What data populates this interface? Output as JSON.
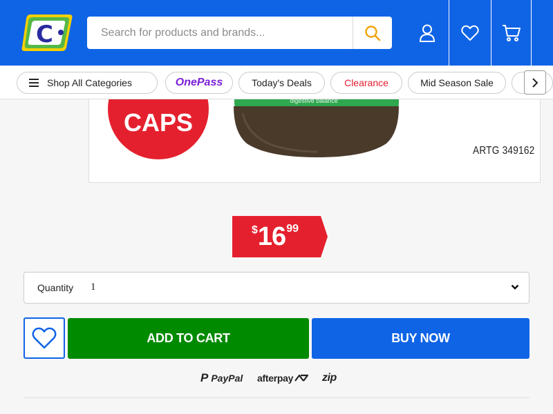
{
  "header": {
    "search_placeholder": "Search for products and brands...",
    "brand_color": "#0f64e6"
  },
  "nav": {
    "all_categories": "Shop All Categories",
    "onepass": "OnePass",
    "deals": "Today's Deals",
    "clearance": "Clearance",
    "mid_season": "Mid Season Sale",
    "next_arrow": "›"
  },
  "product_image": {
    "badge_text": "CAPS",
    "label_text": "digestive balance",
    "artg": "ARTG 349162"
  },
  "price": {
    "currency": "$",
    "dollars": "16",
    "cents": "99"
  },
  "quantity": {
    "label": "Quantity",
    "value": "1"
  },
  "actions": {
    "add_to_cart": "ADD TO CART",
    "buy_now": "BUY NOW"
  },
  "payments": {
    "paypal": "PayPal",
    "afterpay": "afterpay",
    "zip": "zip"
  },
  "colors": {
    "price_red": "#e5202e",
    "add_green": "#008a00",
    "buy_blue": "#0f64e6",
    "onepass_purple": "#7a1fd8"
  }
}
